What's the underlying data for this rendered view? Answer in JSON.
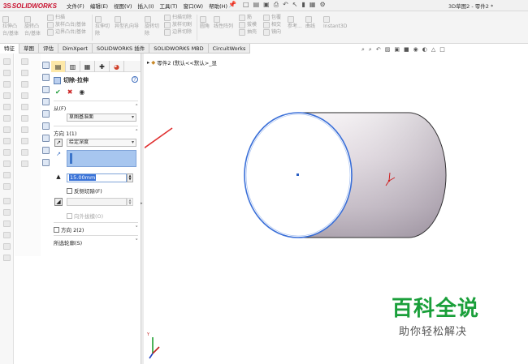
{
  "app": {
    "logo_prefix": "3S",
    "logo_name": "SOLIDWORKS",
    "document_title": "3D草图2 - 零件2 *"
  },
  "menu": [
    "文件(F)",
    "编辑(E)",
    "视图(V)",
    "插入(I)",
    "工具(T)",
    "窗口(W)",
    "帮助(H)"
  ],
  "command_groups": [
    {
      "icon": "extrude-boss-icon",
      "label1": "拉伸凸",
      "label2": "台/基体"
    },
    {
      "icon": "revolve-boss-icon",
      "label1": "旋转凸",
      "label2": "台/基体"
    },
    {
      "icon": "sweep-icon",
      "label1": "扫描",
      "label2": ""
    },
    {
      "icon": "loft-icon",
      "label1": "放样凸台/基体",
      "label2": ""
    },
    {
      "icon": "boundary-icon",
      "label1": "边界凸台/基体",
      "label2": ""
    },
    {
      "icon": "extruded-cut-icon",
      "label1": "拉伸切",
      "label2": "除"
    },
    {
      "icon": "hole-wizard-icon",
      "label1": "异型孔向导",
      "label2": ""
    },
    {
      "icon": "revolved-cut-icon",
      "label1": "旋转切",
      "label2": "除"
    },
    {
      "icon": "swept-cut-icon",
      "label1": "扫描切除",
      "label2": ""
    },
    {
      "icon": "lofted-cut-icon",
      "label1": "放样切割",
      "label2": ""
    },
    {
      "icon": "boundary-cut-icon",
      "label1": "边界切除",
      "label2": ""
    },
    {
      "icon": "fillet-icon",
      "label1": "圆角",
      "label2": ""
    },
    {
      "icon": "linear-pattern-icon",
      "label1": "线性阵列",
      "label2": ""
    },
    {
      "icon": "rib-icon",
      "label1": "筋",
      "label2": ""
    },
    {
      "icon": "draft-icon",
      "label1": "拔模",
      "label2": ""
    },
    {
      "icon": "shell-icon",
      "label1": "抽壳",
      "label2": ""
    },
    {
      "icon": "wrap-icon",
      "label1": "包覆",
      "label2": ""
    },
    {
      "icon": "intersect-icon",
      "label1": "相交",
      "label2": ""
    },
    {
      "icon": "mirror-icon",
      "label1": "镜向",
      "label2": ""
    },
    {
      "icon": "reference-geometry-icon",
      "label1": "参考...",
      "label2": ""
    },
    {
      "icon": "curves-icon",
      "label1": "曲线",
      "label2": ""
    },
    {
      "icon": "instant3d-icon",
      "label1": "Instant3D",
      "label2": ""
    }
  ],
  "tabs": [
    "特征",
    "草图",
    "评估",
    "DimXpert",
    "SOLIDWORKS 插件",
    "SOLIDWORKS MBD",
    "CircuitWorks"
  ],
  "active_tab": "特征",
  "property_manager": {
    "title": "切除-拉伸",
    "help": "?",
    "from_label": "从(F)",
    "from_value": "草图基准面",
    "direction1_label": "方向 1(1)",
    "end_condition": "给定深度",
    "depth_value": "15.00mm",
    "flip_cut_label": "反侧切除(F)",
    "draft_outward_label": "向外拔模(O)",
    "direction2_label": "方向 2(2)",
    "selected_contours_label": "所选轮廓(S)"
  },
  "tree": {
    "part_label": "零件2",
    "config_label": "(默认<<默认>_显"
  },
  "watermark": {
    "title": "百科全说",
    "subtitle": "助你轻松解决"
  },
  "colors": {
    "brand_red": "#c8102e",
    "ok_green": "#1f9d3a",
    "cancel_red": "#cc2222",
    "selection_blue": "#3a73d8",
    "annotation_arrow": "#e03030",
    "watermark_green": "#1a9f3a"
  }
}
